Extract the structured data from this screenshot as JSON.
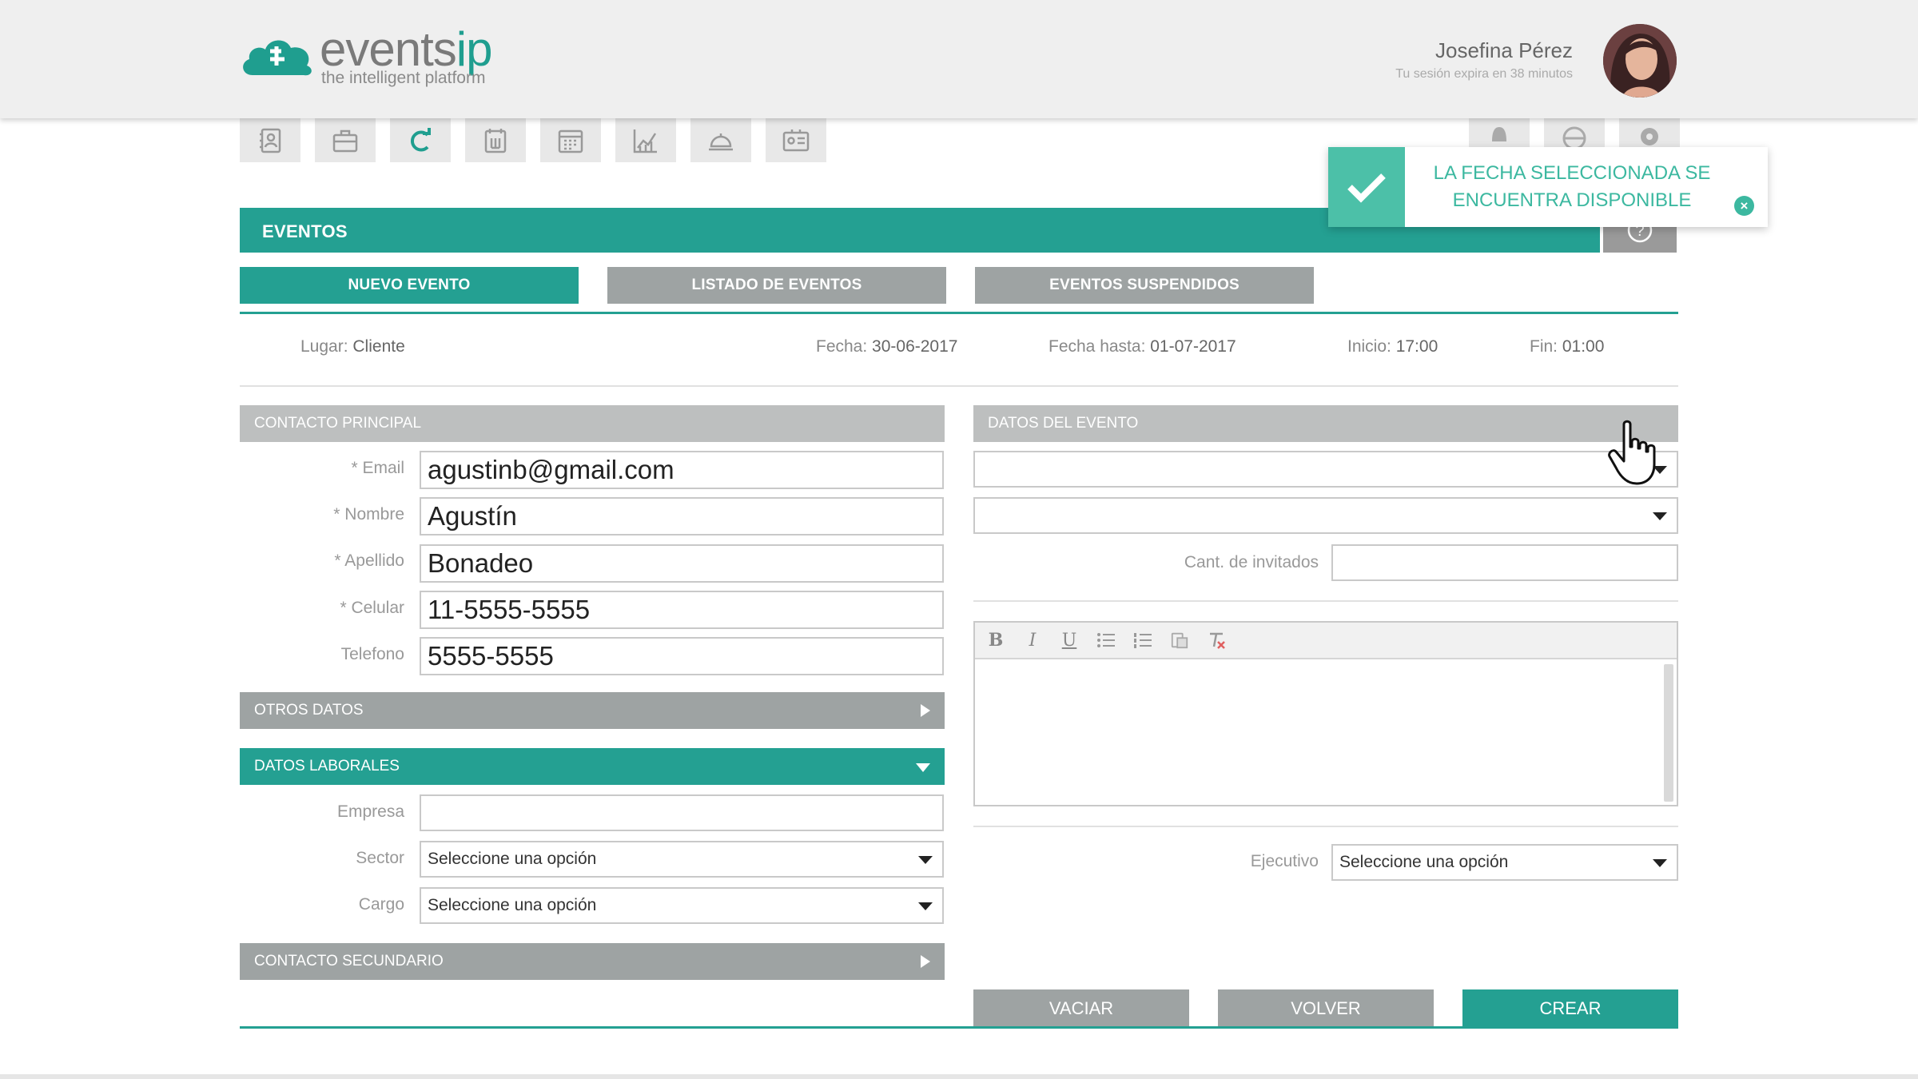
{
  "header": {
    "logo_name": "events",
    "logo_name_accent": "ip",
    "logo_tagline": "the intelligent platform",
    "user_name": "Josefina Pérez",
    "session_text": "Tu sesión expira en 38 minutos"
  },
  "toolbar_icons": [
    "contacts-icon",
    "briefcase-icon",
    "refresh-icon",
    "calendar-day-icon",
    "calendar-month-icon",
    "chart-icon",
    "service-bell-icon",
    "id-card-icon"
  ],
  "right_icons": [
    "bell-icon",
    "globe-icon",
    "gear-icon"
  ],
  "section": {
    "title": "EVENTOS"
  },
  "tabs": [
    {
      "label": "NUEVO EVENTO",
      "active": true
    },
    {
      "label": "LISTADO DE EVENTOS",
      "active": false
    },
    {
      "label": "EVENTOS SUSPENDIDOS",
      "active": false
    }
  ],
  "summary": {
    "lugar_label": "Lugar:",
    "lugar_value": "Cliente",
    "fecha_label": "Fecha:",
    "fecha_value": "30-06-2017",
    "fecha_hasta_label": "Fecha hasta:",
    "fecha_hasta_value": "01-07-2017",
    "inicio_label": "Inicio:",
    "inicio_value": "17:00",
    "fin_label": "Fin:",
    "fin_value": "01:00"
  },
  "contacto_principal": {
    "title": "CONTACTO PRINCIPAL",
    "fields": [
      {
        "label": "* Email",
        "value": "agustinb@gmail.com"
      },
      {
        "label": "* Nombre",
        "value": "Agustín"
      },
      {
        "label": "* Apellido",
        "value": "Bonadeo"
      },
      {
        "label": "* Celular",
        "value": "11-5555-5555"
      },
      {
        "label": "Telefono",
        "value": "5555-5555"
      }
    ]
  },
  "otros_datos": {
    "title": "OTROS DATOS"
  },
  "datos_laborales": {
    "title": "DATOS LABORALES",
    "empresa_label": "Empresa",
    "empresa_value": "",
    "sector_label": "Sector",
    "sector_value": "Seleccione una opción",
    "cargo_label": "Cargo",
    "cargo_value": "Seleccione una opción"
  },
  "contacto_secundario": {
    "title": "CONTACTO SECUNDARIO"
  },
  "datos_evento": {
    "title": "DATOS DEL EVENTO",
    "select1_value": "",
    "select2_value": "",
    "invitados_label": "Cant. de invitados",
    "invitados_value": "",
    "editor_buttons": [
      "B",
      "I",
      "U"
    ],
    "ejecutivo_label": "Ejecutivo",
    "ejecutivo_value": "Seleccione una opción"
  },
  "buttons": {
    "vaciar": "VACIAR",
    "volver": "VOLVER",
    "crear": "CREAR"
  },
  "toast": {
    "message": "LA FECHA SELECCIONADA SE ENCUENTRA DISPONIBLE",
    "close_glyph": "×"
  },
  "colors": {
    "accent": "#24a092",
    "toast": "#4cc0a8",
    "gray_button": "#9ea3a3",
    "panel_header": "#bdbfbf"
  }
}
